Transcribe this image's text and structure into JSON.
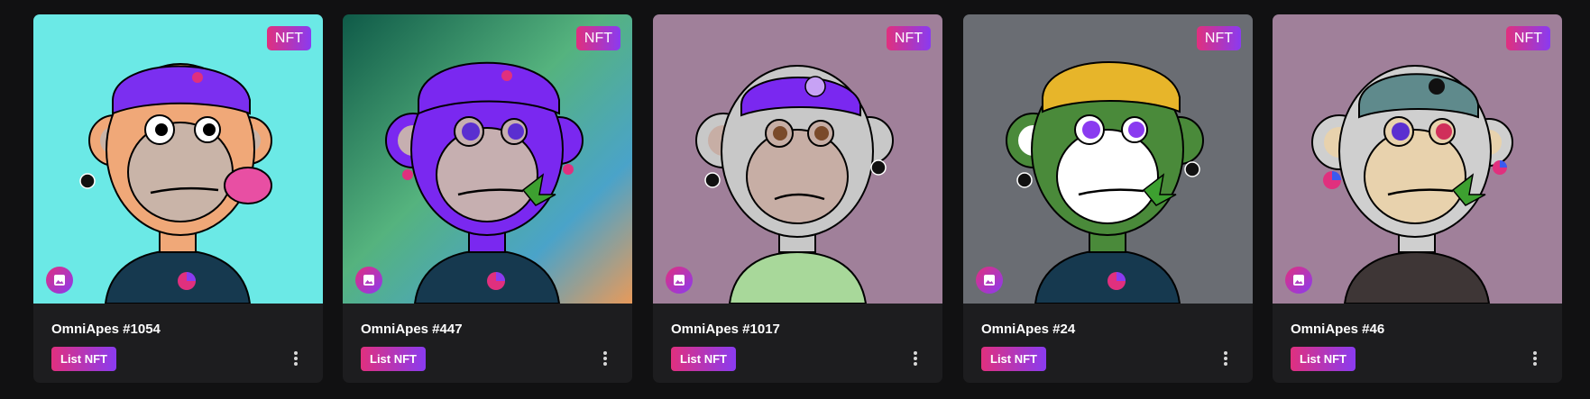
{
  "badge_label": "NFT",
  "list_button_label": "List NFT",
  "colors": {
    "accent_start": "#e0307e",
    "accent_end": "#8a3bf0",
    "card_bg": "#1d1d1f",
    "page_bg": "#111112"
  },
  "cards": [
    {
      "title": "OmniApes #1054",
      "background": "#6be9e6",
      "fur": "#f0a878",
      "face": "#c9b4a8",
      "hat": "#7b2ff0",
      "shirt": "#16394f",
      "icon": "image-icon"
    },
    {
      "title": "OmniApes #447",
      "background": "gradient-teal-orange",
      "fur": "#7a28f0",
      "face": "#c6afb0",
      "hat": "#7a28f0",
      "shirt": "#16394f",
      "icon": "image-icon"
    },
    {
      "title": "OmniApes #1017",
      "background": "#a0809a",
      "fur": "#c8c8c8",
      "face": "#c7aea5",
      "hat": "#7a28f0",
      "shirt": "#a8d89a",
      "icon": "image-icon"
    },
    {
      "title": "OmniApes #24",
      "background": "#6a6d73",
      "fur": "#4a8a3a",
      "face": "#ffffff",
      "hat": "#e7b52a",
      "shirt": "#16394f",
      "icon": "image-icon"
    },
    {
      "title": "OmniApes #46",
      "background": "#a0809a",
      "fur": "#cfcfcf",
      "face": "#e8d2ad",
      "hat": "#5f8a8c",
      "shirt": "#3e3636",
      "icon": "image-icon"
    }
  ]
}
